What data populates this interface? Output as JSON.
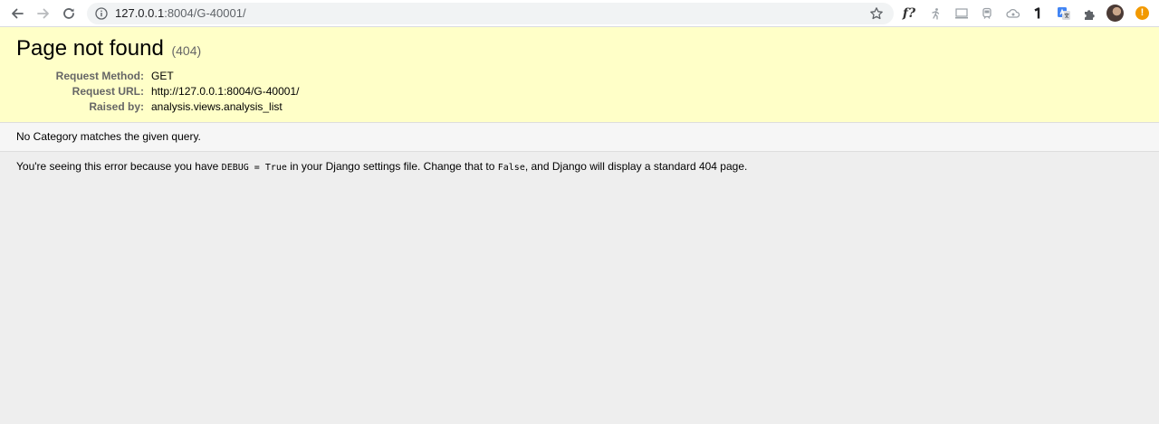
{
  "browser": {
    "address_bar": {
      "host": "127.0.0.1",
      "path": ":8004/G-40001/"
    },
    "extensions": {
      "f_label": "f?"
    },
    "update_badge": "!"
  },
  "page": {
    "title": "Page not found",
    "status_code": "(404)",
    "request_info": [
      {
        "key": "Request Method:",
        "value": "GET"
      },
      {
        "key": "Request URL:",
        "value": "http://127.0.0.1:8004/G-40001/"
      },
      {
        "key": "Raised by:",
        "value": "analysis.views.analysis_list"
      }
    ],
    "message": "No Category matches the given query.",
    "explanation": {
      "part1": "You're seeing this error because you have ",
      "code1": "DEBUG = True",
      "part2": " in your Django settings file. Change that to ",
      "code2": "False",
      "part3": ", and Django will display a standard 404 page."
    }
  }
}
